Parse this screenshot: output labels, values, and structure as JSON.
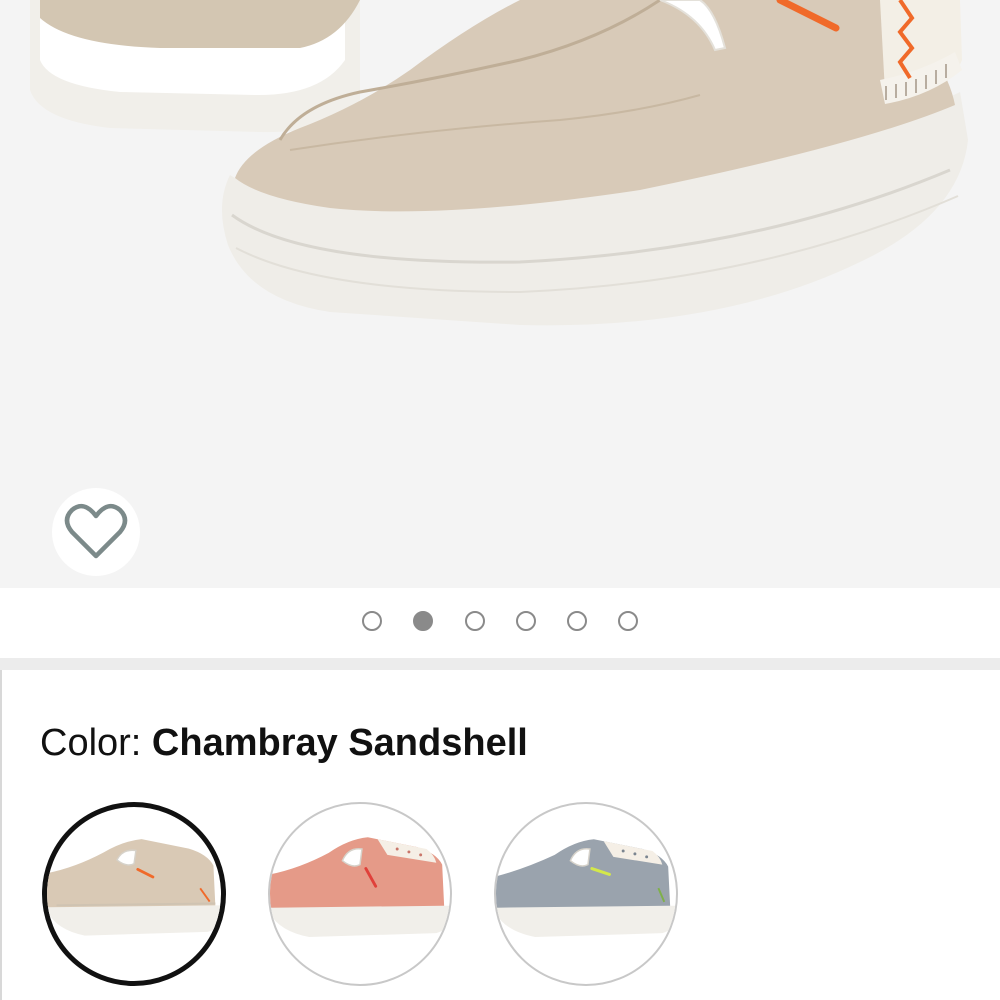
{
  "product_image": {
    "alt": "Canvas slip-on shoe",
    "upper_color": "#d8cab8",
    "sole_color": "#efede8",
    "accent_color": "#f06a2a"
  },
  "wishlist": {
    "icon": "heart-outline-icon",
    "color": "#7c8a8a"
  },
  "carousel": {
    "total": 6,
    "active_index": 2
  },
  "color_selector": {
    "label": "Color: ",
    "selected": "Chambray Sandshell",
    "options": [
      {
        "name": "Chambray Sandshell",
        "upper": "#d9c9b5",
        "accent": "#f06a2a",
        "selected": true
      },
      {
        "name": "Coral",
        "upper": "#e59a88",
        "accent": "#e0403a",
        "selected": false
      },
      {
        "name": "Grey",
        "upper": "#9aa3ad",
        "accent": "#d4e84a",
        "selected": false
      }
    ]
  }
}
